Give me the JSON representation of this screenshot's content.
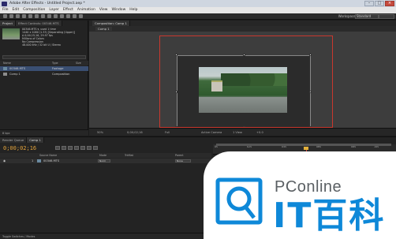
{
  "window": {
    "title": "Adobe After Effects - Untitled Project.aep *"
  },
  "menu": [
    "File",
    "Edit",
    "Composition",
    "Layer",
    "Effect",
    "Animation",
    "View",
    "Window",
    "Help"
  ],
  "toolbar": {
    "workspace_label": "Workspace:",
    "workspace_value": "Standard"
  },
  "project": {
    "tabs": [
      "Project",
      "Effect Controls: 00346.MTS"
    ],
    "footage_name": "00346.MTS ▾, used 1 time",
    "meta": [
      "1440 x 1080 (1.33) [Separating (Upper)]",
      "Δ 0;00;15;16, 29.97 fps",
      "Millions of Colors",
      "No Compression",
      "48.000 kHz / 32 bit U / Stereo"
    ],
    "columns": {
      "name": "Name",
      "type": "Type",
      "size": "Size"
    },
    "items": [
      {
        "name": "00346.MTS",
        "type": "Footage",
        "selected": true
      },
      {
        "name": "Comp 1",
        "type": "Composition",
        "selected": false
      }
    ],
    "bottom": "8 bpc"
  },
  "composition": {
    "tab": "Composition: Comp 1",
    "sub_tab": "Comp 1",
    "viewer_bar": {
      "zoom": "50%",
      "time": "0;00;02;16",
      "resolution": "Full",
      "camera": "Active Camera",
      "views": "1 View",
      "exposure": "+0.0"
    }
  },
  "timeline": {
    "tabs": [
      "Render Queue",
      "Comp 1"
    ],
    "timecode": "0;00;02;16",
    "columns": {
      "source": "Source Name",
      "mode": "Mode",
      "trkmat": "TrkMat",
      "parent": "Parent"
    },
    "layer": {
      "index": "1",
      "name": "00346.MTS",
      "mode": "Norm",
      "parent": "None"
    },
    "ruler": [
      "0s",
      "02s",
      "04s",
      "06s",
      "08s",
      "10s",
      "12s",
      "14s"
    ],
    "bottom": "Toggle Switches / Modes"
  },
  "watermark": {
    "brand": "PConline",
    "slogan": "IT百科",
    "color": "#0e88d8"
  }
}
